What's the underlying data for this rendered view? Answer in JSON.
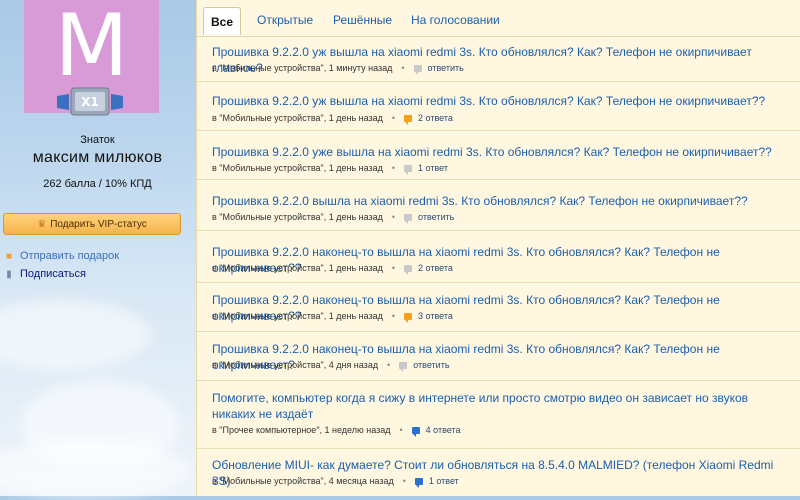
{
  "profile": {
    "avatar_letter": "M",
    "badge_label": "X1",
    "rank": "Знаток",
    "name": "максим милюков",
    "stats": "262 балла / 10% КПД",
    "vip_button": "Подарить VIP-статус",
    "gift_link": "Отправить подарок",
    "subscribe_link": "Подписаться"
  },
  "tabs": [
    {
      "label": "Все",
      "active": true
    },
    {
      "label": "Открытые"
    },
    {
      "label": "Решённые"
    },
    {
      "label": "На голосовании"
    }
  ],
  "questions": [
    {
      "title": "Прошивка 9.2.2.0 уж вышла на xiaomi redmi 3s. Кто обновлялся? Как? Телефон не окирпичивает главное?",
      "meta": "в \"Мобильные устройства\", 1 минуту назад",
      "answers": "ответить",
      "icon": "grey"
    },
    {
      "title": "Прошивка 9.2.2.0 уж вышла на xiaomi redmi 3s. Кто обновлялся? Как? Телефон не окирпичивает??",
      "meta": "в \"Мобильные устройства\", 1 день назад",
      "answers": "2 ответа",
      "icon": "orange"
    },
    {
      "title": "Прошивка 9.2.2.0 уже вышла на xiaomi redmi 3s. Кто обновлялся? Как? Телефон не окирпичивает??",
      "meta": "в \"Мобильные устройства\", 1 день назад",
      "answers": "1 ответ",
      "icon": "grey"
    },
    {
      "title": "Прошивка 9.2.2.0 вышла на xiaomi redmi 3s. Кто обновлялся? Как? Телефон не окирпичивает??",
      "meta": "в \"Мобильные устройства\", 1 день назад",
      "answers": "ответить",
      "icon": "grey"
    },
    {
      "title": "Прошивка 9.2.2.0 наконец-то вышла на xiaomi redmi 3s. Кто обновлялся? Как? Телефон не окирпичивает??",
      "meta": "в \"Мобильные устройства\", 1 день назад",
      "answers": "2 ответа",
      "icon": "grey"
    },
    {
      "title": "Прошивка 9.2.2.0 наконец-то вышла на xiaomi redmi 3s. Кто обновлялся? Как? Телефон не окирпичивает??",
      "meta": "в \"Мобильные устройства\", 1 день назад",
      "answers": "3 ответа",
      "icon": "orange"
    },
    {
      "title": "Прошивка 9.2.2.0 наконец-то вышла на xiaomi redmi 3s. Кто обновлялся? Как? Телефон не окирпичивает?",
      "meta": "в \"Мобильные устройства\", 4 дня назад",
      "answers": "ответить",
      "icon": "grey"
    },
    {
      "title": "Помогите, компьютер когда я сижу в интернете или просто смотрю видео он зависает но звуков никаких не издаёт",
      "meta": "в \"Прочее компьютерное\", 1 неделю назад",
      "answers": "4 ответа",
      "icon": "blue"
    },
    {
      "title": "Обновление MIUI- как думаете? Стоит ли обновляться на 8.5.4.0 MALMIED? (телефон Xiaomi Redmi 3S)",
      "meta": "в \"Мобильные устройства\", 4 месяца назад",
      "answers": "1 ответ",
      "icon": "blue"
    }
  ],
  "colors": {
    "link": "#1a5fb0",
    "panel": "#fff7e0",
    "avatar": "#d99ad8",
    "vip": "#f6b24a"
  }
}
